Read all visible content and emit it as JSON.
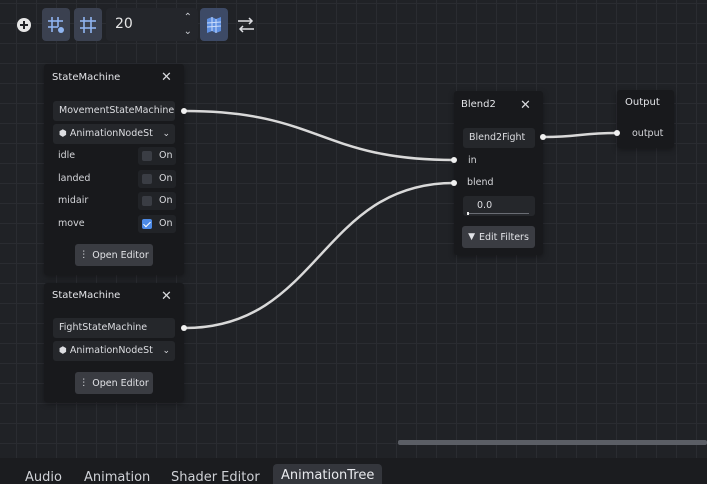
{
  "toolbar": {
    "zoom_value": "20",
    "icons": [
      "add-node-icon",
      "snap-grid-icon",
      "grid-icon",
      "minimap-icon",
      "arrange-nodes-icon"
    ]
  },
  "nodes": {
    "state_machine_1": {
      "title": "StateMachine",
      "machine_name": "MovementStateMachine",
      "resource_type": "AnimationNodeSt",
      "rows": [
        {
          "label": "idle",
          "toggle": "On",
          "checked": false
        },
        {
          "label": "landed",
          "toggle": "On",
          "checked": false
        },
        {
          "label": "midair",
          "toggle": "On",
          "checked": false
        },
        {
          "label": "move",
          "toggle": "On",
          "checked": true
        }
      ],
      "open_editor": "Open Editor"
    },
    "state_machine_2": {
      "title": "StateMachine",
      "machine_name": "FightStateMachine",
      "resource_type": "AnimationNodeSt",
      "open_editor": "Open Editor"
    },
    "blend2": {
      "title": "Blend2",
      "name": "Blend2Fight",
      "port_in": "in",
      "port_blend": "blend",
      "blend_amount": "0.0",
      "edit_filters": "Edit Filters"
    },
    "output": {
      "title": "Output",
      "port_output": "output"
    }
  },
  "bottom_tabs": [
    {
      "label": "Audio",
      "active": false
    },
    {
      "label": "Animation",
      "active": false
    },
    {
      "label": "Shader Editor",
      "active": false
    },
    {
      "label": "AnimationTree",
      "active": true
    }
  ],
  "colors": {
    "canvas_bg": "#202226",
    "node_bg": "#18191c",
    "accent": "#4d8ae6",
    "connection": "#d9d9d9"
  }
}
